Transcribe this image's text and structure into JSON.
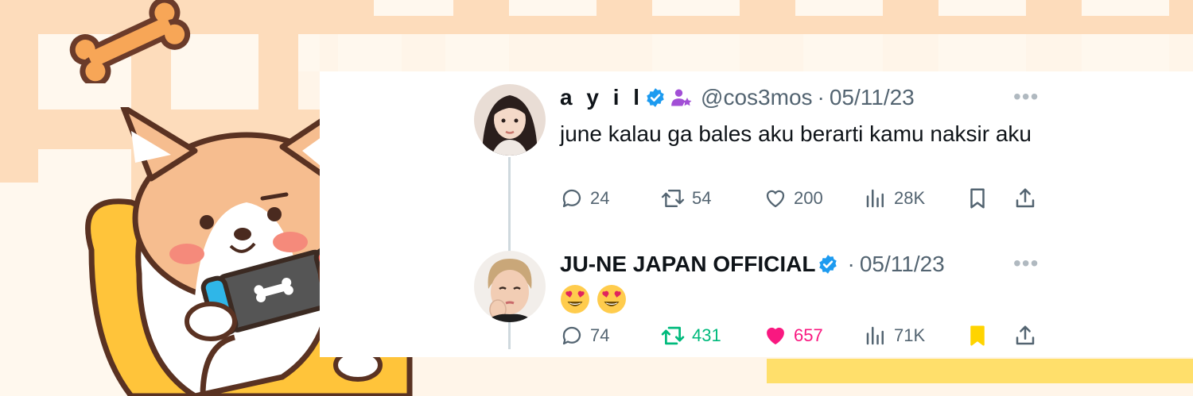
{
  "tweets": [
    {
      "display_name": "a y i l",
      "handle": "@cos3mos",
      "separator": "·",
      "date": "05/11/23",
      "text": "june kalau ga bales aku berarti kamu naksir aku",
      "emoji": [],
      "stats": {
        "replies": "24",
        "retweets": "54",
        "likes": "200",
        "views": "28K"
      },
      "liked": false,
      "retweeted": false,
      "bookmarked": false
    },
    {
      "display_name": "JU-NE JAPAN OFFICIAL",
      "handle": "",
      "separator": "·",
      "date": "05/11/23",
      "text": "",
      "emoji": [
        "😍",
        "😍"
      ],
      "stats": {
        "replies": "74",
        "retweets": "431",
        "likes": "657",
        "views": "71K"
      },
      "liked": true,
      "retweeted": true,
      "bookmarked": true
    }
  ],
  "more_label": "•••",
  "colors": {
    "verified": "#1d9bf0",
    "retweet_active": "#00ba7c",
    "like_active": "#f91880",
    "bookmark_active": "#ffd400",
    "icon_default": "#536471",
    "badge_purple": "#a24fd6"
  }
}
